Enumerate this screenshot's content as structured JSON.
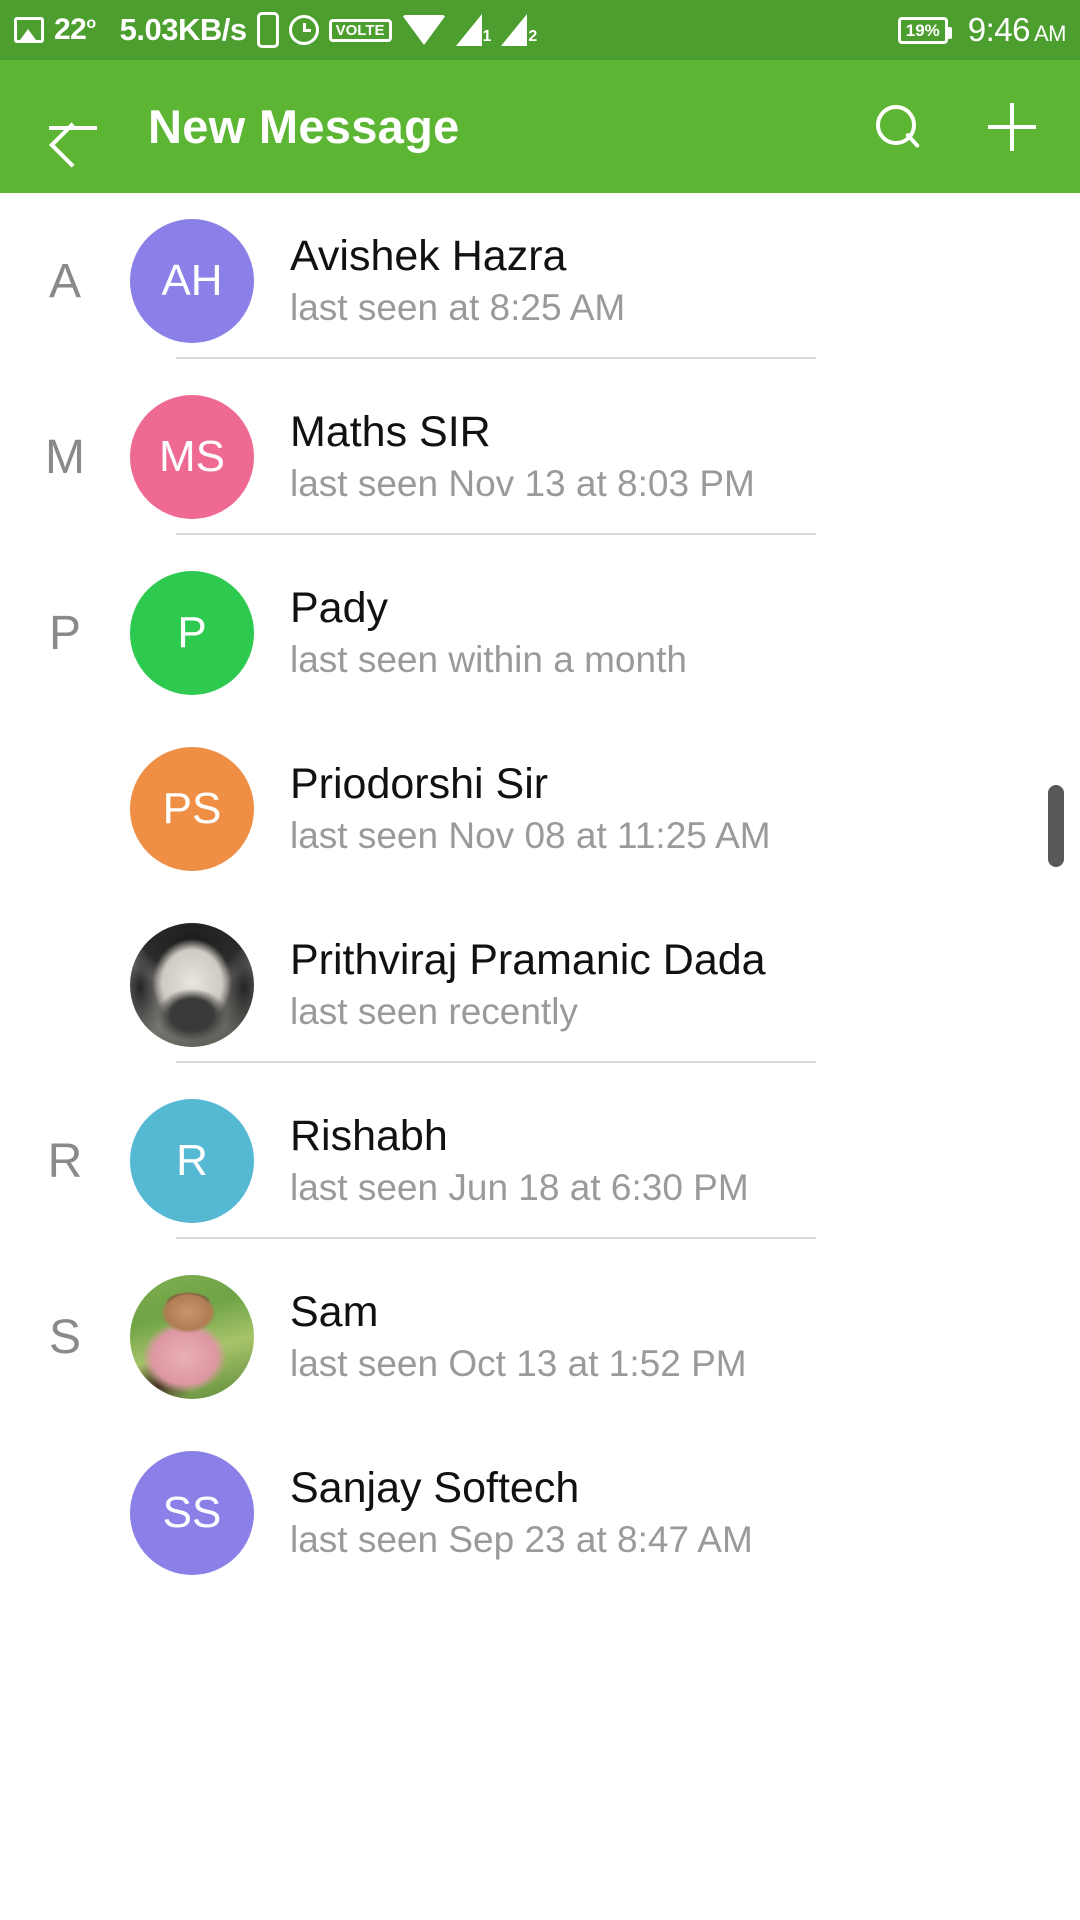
{
  "status_bar": {
    "image_icon": "image-icon",
    "temperature": "22",
    "temperature_unit": "o",
    "network_speed": "5.03KB/s",
    "phone_icon": "phone-icon",
    "alarm_icon": "alarm-icon",
    "volte_label": "VOLTE",
    "wifi_icon": "wifi-icon",
    "signal_1_label": "1",
    "signal_2_label": "2",
    "battery_percent": "19%",
    "clock_time": "9:46",
    "clock_meridiem": "AM"
  },
  "app_bar": {
    "back_icon": "back-arrow-icon",
    "title": "New Message",
    "search_icon": "search-icon",
    "add_icon": "plus-icon",
    "background_color": "#5cb533"
  },
  "colors": {
    "status_bar_green": "#4c9e2f",
    "app_bar_green": "#5cb533",
    "avatar_purple": "#8b7fe8",
    "avatar_pink": "#ef6a93",
    "avatar_green": "#2ec94f",
    "avatar_orange": "#ef8f45",
    "avatar_blue": "#56b9d4",
    "avatar_periwinkle": "#8b7fe8",
    "divider": "#d8d8d8",
    "name_text": "#111111",
    "status_text": "#9a9a9a",
    "section_letter": "#8a8a8a",
    "scrollbar": "#585858"
  },
  "contacts": [
    {
      "section": "A",
      "name": "Avishek Hazra",
      "status": "last seen at 8:25 AM",
      "initials": "AH",
      "avatar_type": "initials",
      "avatar_color": "#8b7fe8",
      "show_section": true,
      "divider_after": true
    },
    {
      "section": "M",
      "name": "Maths SIR",
      "status": "last seen Nov 13 at 8:03 PM",
      "initials": "MS",
      "avatar_type": "initials",
      "avatar_color": "#ef6a93",
      "show_section": true,
      "divider_after": true
    },
    {
      "section": "P",
      "name": "Pady",
      "status": "last seen within a month",
      "initials": "P",
      "avatar_type": "initials",
      "avatar_color": "#2ec94f",
      "show_section": true,
      "divider_after": false
    },
    {
      "section": "P",
      "name": "Priodorshi Sir",
      "status": "last seen Nov 08 at 11:25 AM",
      "initials": "PS",
      "avatar_type": "initials",
      "avatar_color": "#ef8f45",
      "show_section": false,
      "divider_after": false
    },
    {
      "section": "P",
      "name": "Prithviraj Pramanic Dada",
      "status": "last seen recently",
      "initials": "",
      "avatar_type": "photo",
      "avatar_photo": "photo-prithviraj",
      "avatar_color": "",
      "show_section": false,
      "divider_after": true
    },
    {
      "section": "R",
      "name": "Rishabh",
      "status": "last seen Jun 18 at 6:30 PM",
      "initials": "R",
      "avatar_type": "initials",
      "avatar_color": "#56b9d4",
      "show_section": true,
      "divider_after": true
    },
    {
      "section": "S",
      "name": "Sam",
      "status": "last seen Oct 13 at 1:52 PM",
      "initials": "",
      "avatar_type": "photo",
      "avatar_photo": "photo-sam",
      "avatar_color": "",
      "show_section": true,
      "divider_after": false
    },
    {
      "section": "S",
      "name": "Sanjay Softech",
      "status": "last seen Sep 23 at 8:47 AM",
      "initials": "SS",
      "avatar_type": "initials",
      "avatar_color": "#8b7fe8",
      "show_section": false,
      "divider_after": false
    }
  ],
  "scrollbar": {
    "name": "list-scrollbar"
  }
}
